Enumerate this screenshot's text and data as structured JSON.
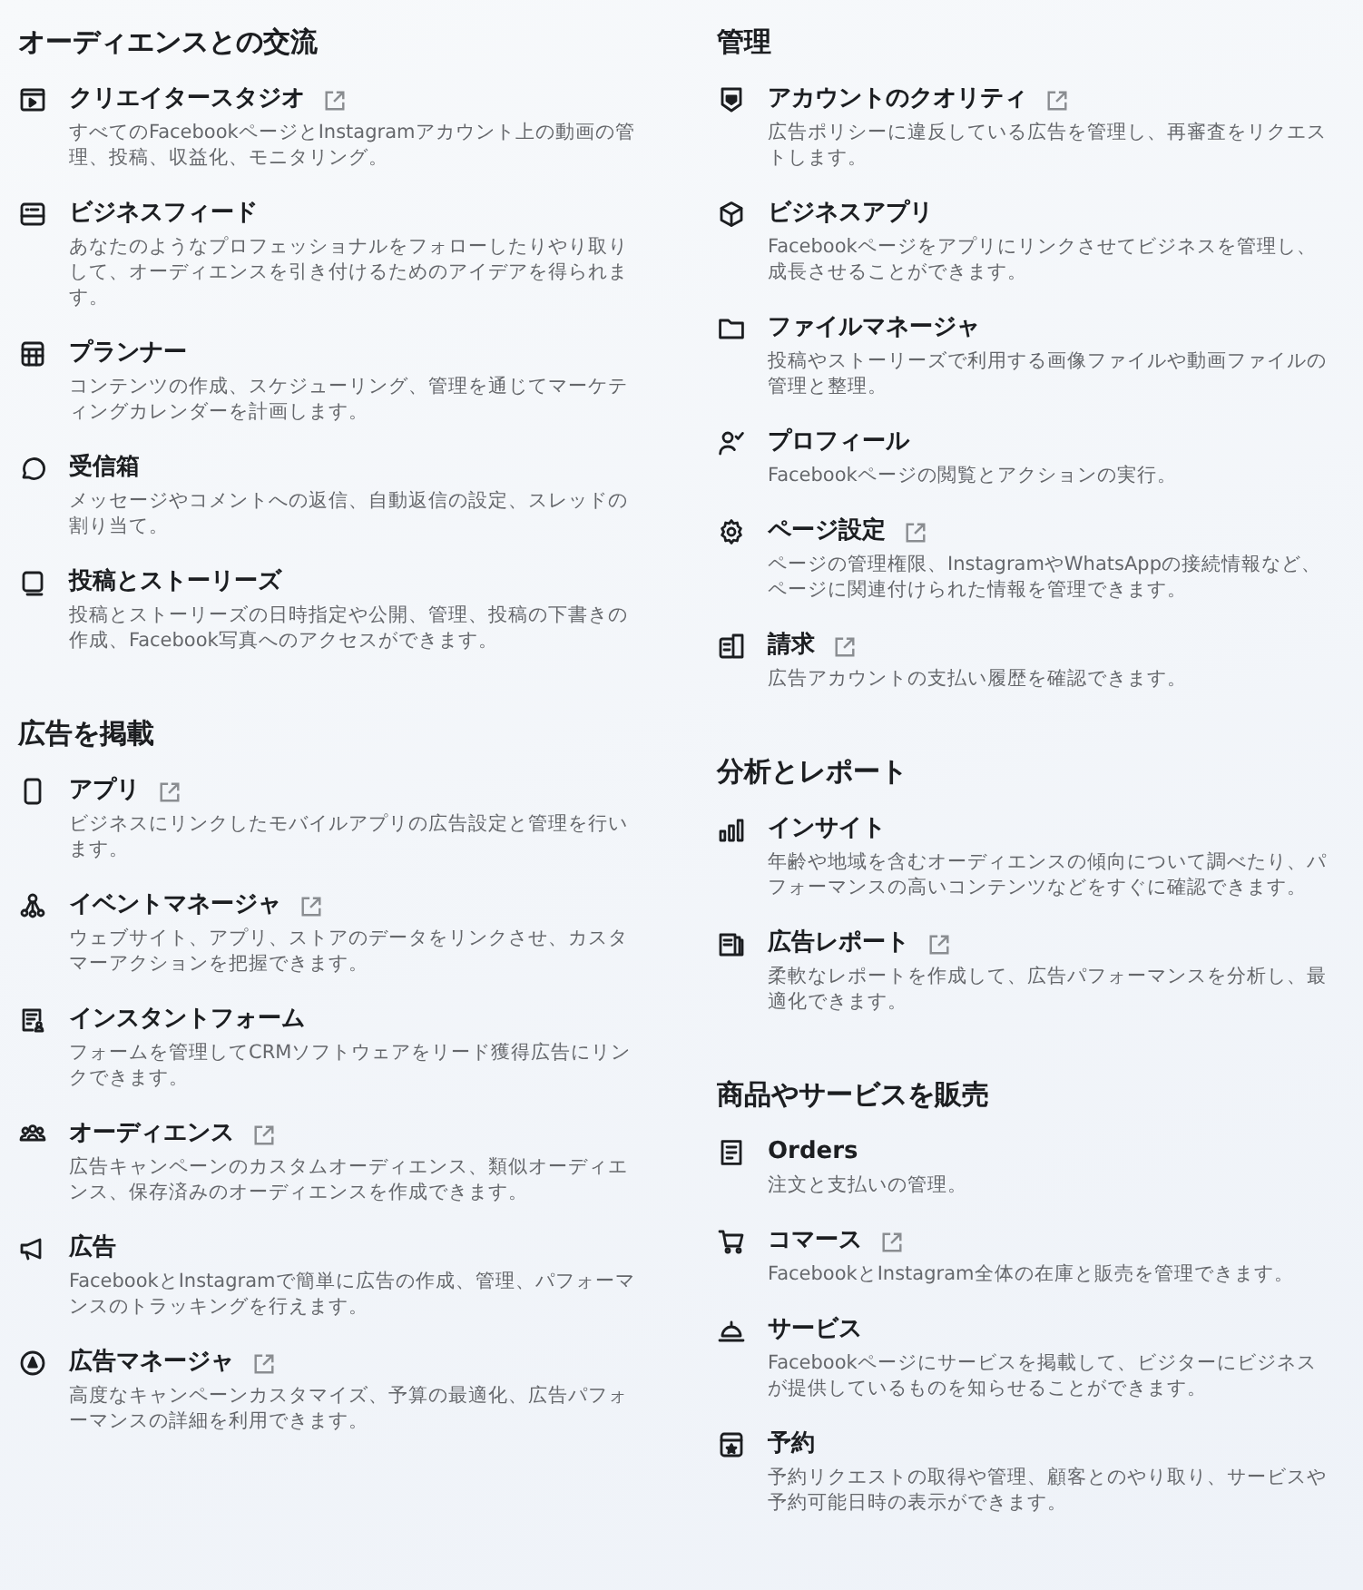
{
  "columns": [
    {
      "sections": [
        {
          "title": "オーディエンスとの交流",
          "items": [
            {
              "title": "クリエイタースタジオ",
              "external": true,
              "description": "すべてのFacebookページとInstagramアカウント上の動画の管理、投稿、収益化、モニタリング。"
            },
            {
              "title": "ビジネスフィード",
              "external": false,
              "description": "あなたのようなプロフェッショナルをフォローしたりやり取りして、オーディエンスを引き付けるためのアイデアを得られます。"
            },
            {
              "title": "プランナー",
              "external": false,
              "description": "コンテンツの作成、スケジューリング、管理を通じてマーケティングカレンダーを計画します。"
            },
            {
              "title": "受信箱",
              "external": false,
              "description": "メッセージやコメントへの返信、自動返信の設定、スレッドの割り当て。"
            },
            {
              "title": "投稿とストーリーズ",
              "external": false,
              "description": "投稿とストーリーズの日時指定や公開、管理、投稿の下書きの作成、Facebook写真へのアクセスができます。"
            }
          ]
        },
        {
          "title": "広告を掲載",
          "items": [
            {
              "title": "アプリ",
              "external": true,
              "description": "ビジネスにリンクしたモバイルアプリの広告設定と管理を行います。"
            },
            {
              "title": "イベントマネージャ",
              "external": true,
              "description": "ウェブサイト、アプリ、ストアのデータをリンクさせ、カスタマーアクションを把握できます。"
            },
            {
              "title": "インスタントフォーム",
              "external": false,
              "description": "フォームを管理してCRMソフトウェアをリード獲得広告にリンクできます。"
            },
            {
              "title": "オーディエンス",
              "external": true,
              "description": "広告キャンペーンのカスタムオーディエンス、類似オーディエンス、保存済みのオーディエンスを作成できます。"
            },
            {
              "title": "広告",
              "external": false,
              "description": "FacebookとInstagramで簡単に広告の作成、管理、パフォーマンスのトラッキングを行えます。"
            },
            {
              "title": "広告マネージャ",
              "external": true,
              "description": "高度なキャンペーンカスタマイズ、予算の最適化、広告パフォーマンスの詳細を利用できます。"
            }
          ]
        }
      ]
    },
    {
      "sections": [
        {
          "title": "管理",
          "items": [
            {
              "title": "アカウントのクオリティ",
              "external": true,
              "description": "広告ポリシーに違反している広告を管理し、再審査をリクエストします。"
            },
            {
              "title": "ビジネスアプリ",
              "external": false,
              "description": "Facebookページをアプリにリンクさせてビジネスを管理し、成長させることができます。"
            },
            {
              "title": "ファイルマネージャ",
              "external": false,
              "description": "投稿やストーリーズで利用する画像ファイルや動画ファイルの管理と整理。"
            },
            {
              "title": "プロフィール",
              "external": false,
              "description": "Facebookページの閲覧とアクションの実行。"
            },
            {
              "title": "ページ設定",
              "external": true,
              "description": "ページの管理権限、InstagramやWhatsAppの接続情報など、ページに関連付けられた情報を管理できます。"
            },
            {
              "title": "請求",
              "external": true,
              "description": "広告アカウントの支払い履歴を確認できます。"
            }
          ]
        },
        {
          "title": "分析とレポート",
          "items": [
            {
              "title": "インサイト",
              "external": false,
              "description": "年齢や地域を含むオーディエンスの傾向について調べたり、パフォーマンスの高いコンテンツなどをすぐに確認できます。"
            },
            {
              "title": "広告レポート",
              "external": true,
              "description": "柔軟なレポートを作成して、広告パフォーマンスを分析し、最適化できます。"
            }
          ]
        },
        {
          "title": "商品やサービスを販売",
          "items": [
            {
              "title": "Orders",
              "external": false,
              "description": "注文と支払いの管理。"
            },
            {
              "title": "コマース",
              "external": true,
              "description": "FacebookとInstagram全体の在庫と販売を管理できます。"
            },
            {
              "title": "サービス",
              "external": false,
              "description": "Facebookページにサービスを掲載して、ビジターにビジネスが提供しているものを知らせることができます。"
            },
            {
              "title": "予約",
              "external": false,
              "description": "予約リクエストの取得や管理、顧客とのやり取り、サービスや予約可能日時の表示ができます。"
            }
          ]
        }
      ]
    }
  ]
}
